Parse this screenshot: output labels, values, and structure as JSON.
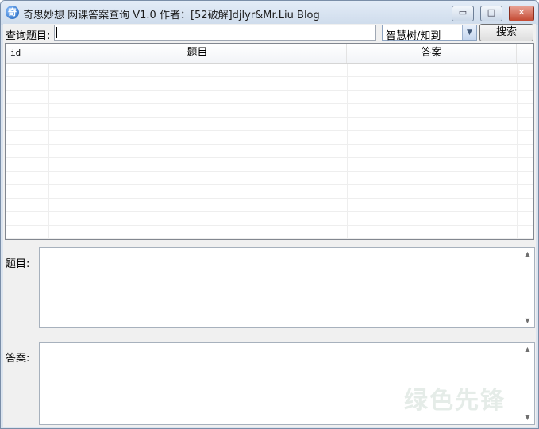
{
  "window": {
    "title": "奇思妙想 网课答案查询 V1.0 作者：[52破解]djlyr&Mr.Liu Blog",
    "icon": "app-icon",
    "controls": {
      "minimize": "▭",
      "maximize": "□",
      "close": "✕"
    }
  },
  "toolbar": {
    "query_label": "查询题目:",
    "search_value": "",
    "platform_selected": "智慧树/知到",
    "dropdown_arrow": "▼",
    "search_button": "搜索"
  },
  "grid": {
    "columns": [
      "id",
      "题目",
      "答案"
    ],
    "rows": []
  },
  "question_field": {
    "label": "题目:",
    "value": ""
  },
  "answer_field": {
    "label": "答案:",
    "value": ""
  },
  "scroll": {
    "up": "▲",
    "down": "▼"
  },
  "watermark": "绿色先锋"
}
